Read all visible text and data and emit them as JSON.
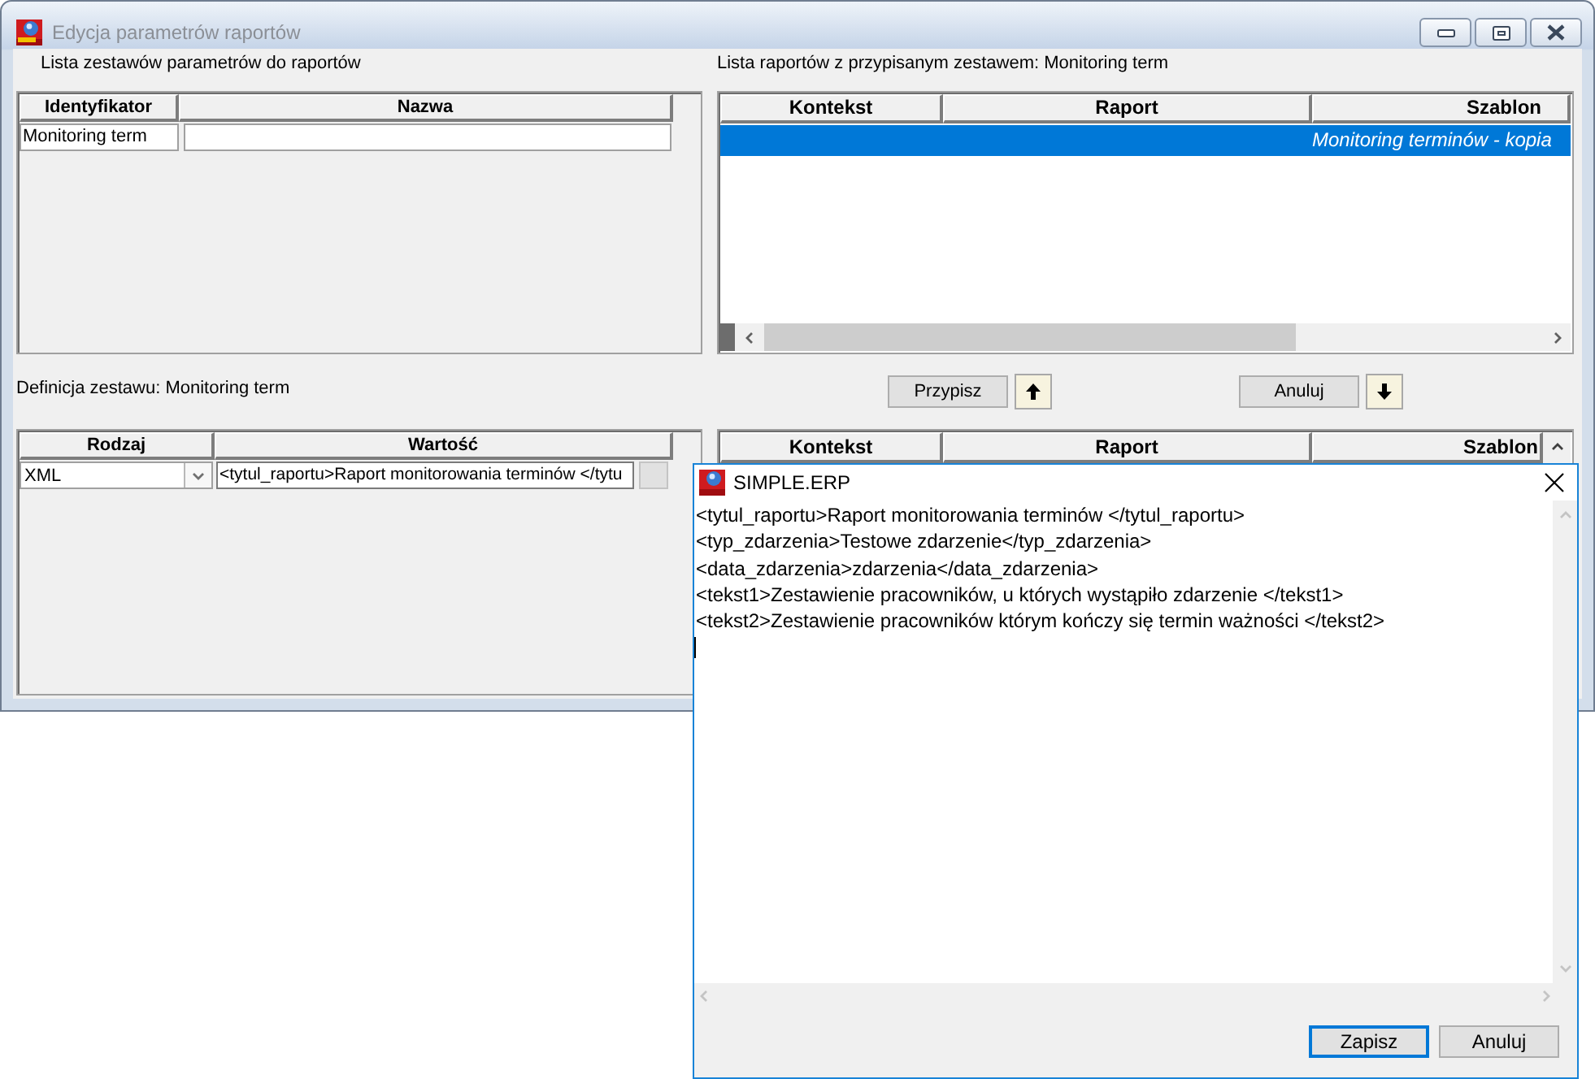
{
  "main_window": {
    "title": "Edycja parametrów raportów",
    "active": false
  },
  "parameter_sets": {
    "label": "Lista zestawów parametrów do raportów",
    "columns": [
      "Identyfikator",
      "Nazwa"
    ],
    "rows": [
      {
        "identifier": "Monitoring term"
      }
    ]
  },
  "assigned_reports": {
    "label": "Lista raportów z przypisanym zestawem: Monitoring term",
    "columns": [
      "Kontekst",
      "Raport",
      "Szablon"
    ],
    "rows": [
      {
        "template": "Monitoring terminów - kopia",
        "selected": true
      }
    ]
  },
  "set_definition": {
    "label": "Definicja zestawu: Monitoring term",
    "columns": [
      "Rodzaj",
      "Wartość"
    ],
    "rows": [
      {
        "format": "XML",
        "value": "<tytul_raportu>Raport monitorowania terminów </tytu"
      }
    ]
  },
  "actions": {
    "assign_button": "Przypisz",
    "cancel_button": "Anuluj"
  },
  "available_reports": {
    "columns": [
      "Kontekst",
      "Raport",
      "Szablon"
    ]
  },
  "dialog": {
    "title": "SIMPLE.ERP",
    "lines": [
      "<tytul_raportu>Raport monitorowania terminów </tytul_raportu>",
      "<typ_zdarzenia>Testowe zdarzenie</typ_zdarzenia>",
      "<data_zdarzenia>zdarzenia</data_zdarzenia>",
      "<tekst1>Zestawienie pracowników, u których wystąpiło zdarzenie </tekst1>",
      "<tekst2>Zestawienie pracowników którym kończy się termin ważności </tekst2>"
    ],
    "buttons": [
      {
        "label": "Zapisz",
        "focused": true
      },
      {
        "label": "Anuluj",
        "focused": false
      }
    ]
  }
}
